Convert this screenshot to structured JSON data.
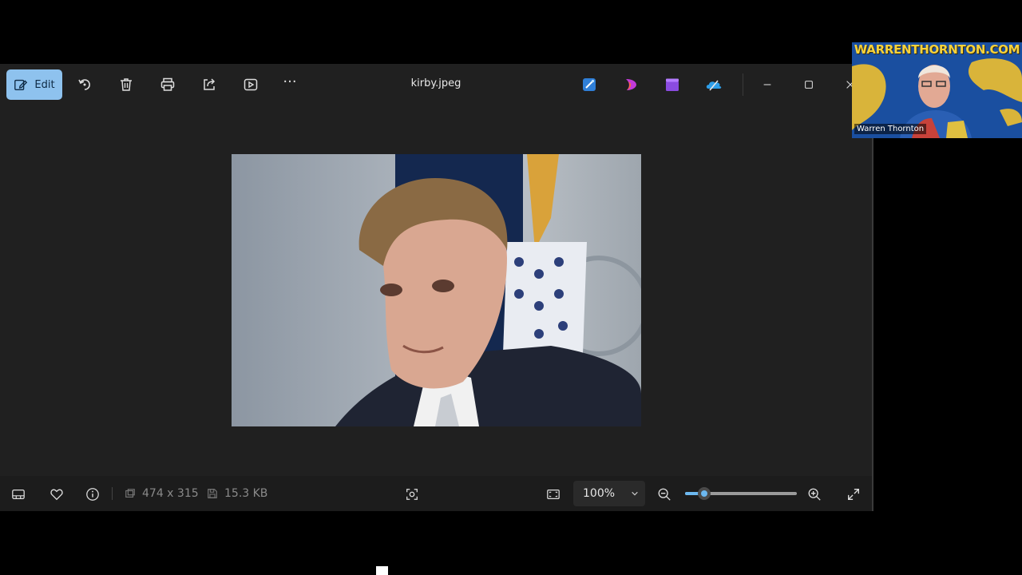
{
  "toolbar": {
    "edit_label": "Edit",
    "file_name": "kirby.jpeg",
    "more_label": "···"
  },
  "bottombar": {
    "dimensions": "474 x 315",
    "file_size": "15.3 KB",
    "zoom_value": "100%",
    "zoom_slider_fraction": 0.17
  },
  "webcam": {
    "brand": "WARRENTHORNTON.COM",
    "name": "Warren Thornton"
  },
  "colors": {
    "accent": "#8ec2ee",
    "slider": "#6cb8f0",
    "window_bg": "#202020"
  }
}
